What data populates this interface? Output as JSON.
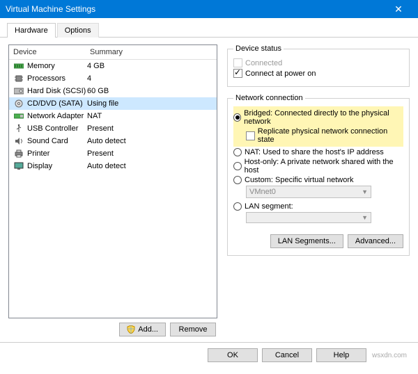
{
  "window": {
    "title": "Virtual Machine Settings",
    "close": "✕"
  },
  "tabs": {
    "hardware": "Hardware",
    "options": "Options"
  },
  "list": {
    "col_device": "Device",
    "col_summary": "Summary",
    "rows": [
      {
        "device": "Memory",
        "summary": "4 GB"
      },
      {
        "device": "Processors",
        "summary": "4"
      },
      {
        "device": "Hard Disk (SCSI)",
        "summary": "60 GB"
      },
      {
        "device": "CD/DVD (SATA)",
        "summary": "Using file"
      },
      {
        "device": "Network Adapter",
        "summary": "NAT"
      },
      {
        "device": "USB Controller",
        "summary": "Present"
      },
      {
        "device": "Sound Card",
        "summary": "Auto detect"
      },
      {
        "device": "Printer",
        "summary": "Present"
      },
      {
        "device": "Display",
        "summary": "Auto detect"
      }
    ],
    "add": "Add...",
    "remove": "Remove"
  },
  "status": {
    "legend": "Device status",
    "connected": "Connected",
    "power_on": "Connect at power on"
  },
  "net": {
    "legend": "Network connection",
    "bridged": "Bridged: Connected directly to the physical network",
    "replicate": "Replicate physical network connection state",
    "nat": "NAT: Used to share the host's IP address",
    "hostonly": "Host-only: A private network shared with the host",
    "custom": "Custom: Specific virtual network",
    "vmnet": "VMnet0",
    "lanseg": "LAN segment:",
    "btn_lan": "LAN Segments...",
    "btn_adv": "Advanced..."
  },
  "footer": {
    "ok": "OK",
    "cancel": "Cancel",
    "help": "Help",
    "watermark": "wsxdn.com"
  }
}
